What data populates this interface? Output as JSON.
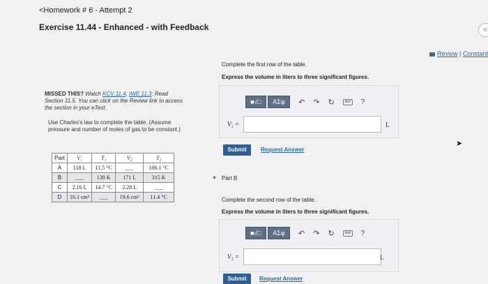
{
  "header": {
    "back_label": "<Homework # 6 - Attempt 2",
    "title": "Exercise 11.44 - Enhanced - with Feedback",
    "collapse_symbol": "<"
  },
  "resources": {
    "review_label": "Review",
    "separator": "|",
    "constants_label": "Constants",
    "trailing_separator": "|"
  },
  "hint": {
    "prefix": "MISSED THIS?",
    "watch_text": "Watch",
    "video_link": "KCV 11.4",
    "comma": ",",
    "iwe_link": "IWE 11.3",
    "read_text": "; Read Section 11.5. You can click on the Review link to access the section in your eText."
  },
  "instructions": "Use Charles's law to complete the table. (Assume pressure and number of moles of gas to be constant.)",
  "table": {
    "headers": [
      "Part",
      "V₁",
      "T₁",
      "V₂",
      "T₂"
    ],
    "rows": [
      {
        "part": "A",
        "v1": "118 L",
        "t1": "11.5 °C",
        "v2": "___",
        "t2": "106.1 °C"
      },
      {
        "part": "B",
        "v1": "___",
        "t1": "139 K",
        "v2": "171 L",
        "t2": "315 K"
      },
      {
        "part": "C",
        "v1": "2.16 L",
        "t1": "14.7 °C",
        "v2": "2.28 L",
        "t2": "___"
      },
      {
        "part": "D",
        "v1": "16.1 cm³",
        "t1": "___",
        "v2": "19.6 cm³",
        "t2": "11.4 °C"
      }
    ]
  },
  "part_a": {
    "intro": "Complete the first row of the table.",
    "express": "Express the volume in liters to three significant figures.",
    "variable": "V₂ =",
    "unit": "L",
    "input_value": "",
    "submit_label": "Submit",
    "request_label": "Request Answer"
  },
  "part_b": {
    "label": "Part B",
    "intro": "Complete the second row of the table.",
    "express": "Express the volume in liters to three significant figures.",
    "variable": "V₁ =",
    "unit": "L",
    "input_value": "",
    "submit_label": "Submit",
    "request_label": "Request Answer"
  },
  "toolbar": {
    "templates_label": "■√□",
    "symbols_label": "ΑΣφ",
    "undo_icon": "↶",
    "redo_icon": "↷",
    "reset_icon": "↻",
    "keyboard_icon": "kbd",
    "help_label": "?"
  },
  "icons": {
    "caret": "▼",
    "cursor": "➤"
  },
  "colors": {
    "accent_link": "#2b6aa8",
    "submit_bg": "#2f5f95",
    "toolbar_btn": "#5f6f86"
  }
}
